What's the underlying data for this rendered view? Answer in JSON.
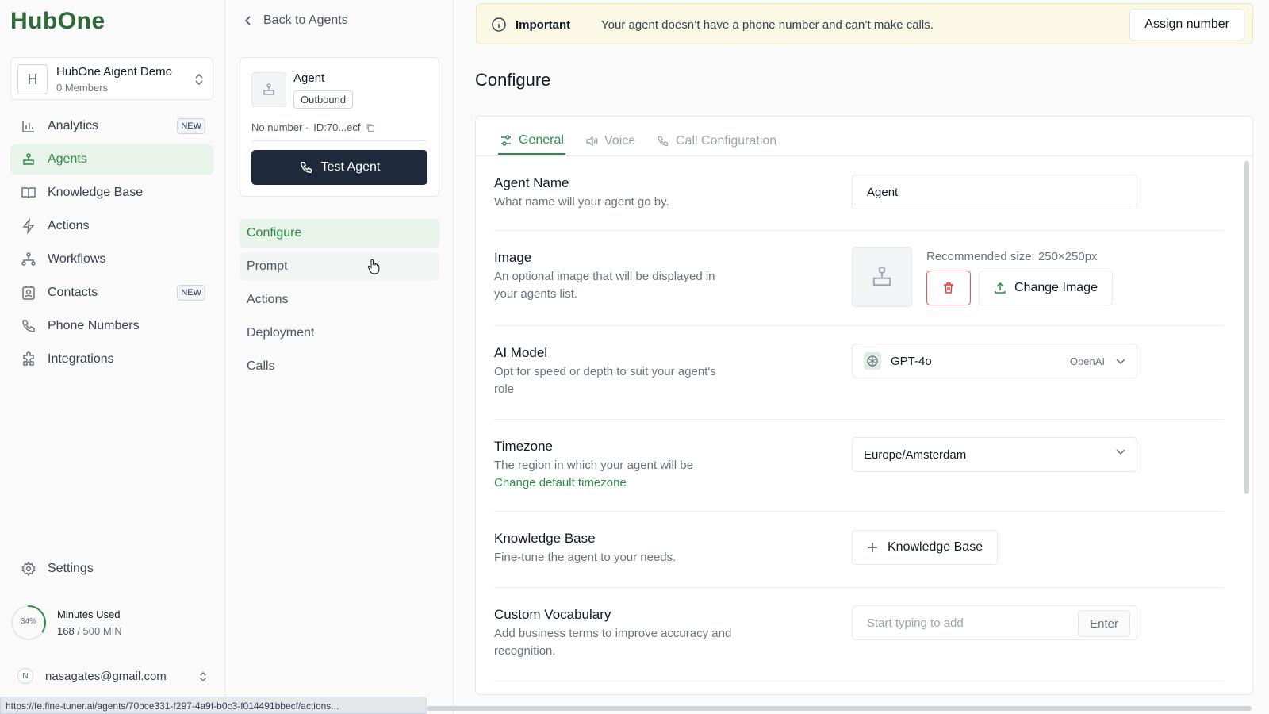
{
  "sidebar": {
    "logo": "HubOne",
    "workspace": {
      "initial": "H",
      "name": "HubOne Aigent Demo",
      "members": "0 Members"
    },
    "items": [
      {
        "label": "Analytics",
        "badge": "NEW"
      },
      {
        "label": "Agents"
      },
      {
        "label": "Knowledge Base"
      },
      {
        "label": "Actions"
      },
      {
        "label": "Workflows"
      },
      {
        "label": "Contacts",
        "badge": "NEW"
      },
      {
        "label": "Phone Numbers"
      },
      {
        "label": "Integrations"
      }
    ],
    "settings": "Settings",
    "minutes": {
      "percent_label": "34%",
      "percent": 34,
      "label": "Minutes Used",
      "used": "168",
      "total": "/ 500 MIN"
    },
    "user": {
      "initial": "N",
      "email": "nasagates@gmail.com"
    }
  },
  "status_url": "https://fe.fine-tuner.ai/agents/70bce331-f297-4a9f-b0c3-f014491bbecf/actions...",
  "agent_panel": {
    "back": "Back to Agents",
    "name": "Agent",
    "tag": "Outbound",
    "number": "No number ·",
    "id": "ID:70...ecf",
    "test_button": "Test Agent",
    "subnav": [
      "Configure",
      "Prompt",
      "Actions",
      "Deployment",
      "Calls"
    ]
  },
  "banner": {
    "strong": "Important",
    "message": "Your agent doesn’t have a phone number and can’t make calls.",
    "button": "Assign number"
  },
  "main": {
    "title": "Configure",
    "tabs": [
      "General",
      "Voice",
      "Call Configuration"
    ],
    "agent_name": {
      "title": "Agent Name",
      "desc": "What name will your agent go by.",
      "value": "Agent"
    },
    "image": {
      "title": "Image",
      "desc": "An optional image that will be displayed in your agents list.",
      "recommended": "Recommended size: 250×250px",
      "change": "Change Image"
    },
    "ai_model": {
      "title": "AI Model",
      "desc": "Opt for speed or depth to suit your agent's role",
      "value": "GPT-4o",
      "provider": "OpenAI"
    },
    "timezone": {
      "title": "Timezone",
      "desc": "The region in which your agent will be",
      "link": "Change default timezone",
      "value": "Europe/Amsterdam"
    },
    "knowledge_base": {
      "title": "Knowledge Base",
      "desc": "Fine-tune the agent to your needs.",
      "button": "Knowledge Base"
    },
    "vocabulary": {
      "title": "Custom Vocabulary",
      "desc": "Add business terms to improve accuracy and recognition.",
      "placeholder": "Start typing to add",
      "enter": "Enter"
    }
  },
  "colors": {
    "accent": "#2f8a4a",
    "accent_bg": "#e8f3ea",
    "dark_button": "#1e293b",
    "banner_bg": "#fbf8e6",
    "danger": "#dc3b3b"
  }
}
